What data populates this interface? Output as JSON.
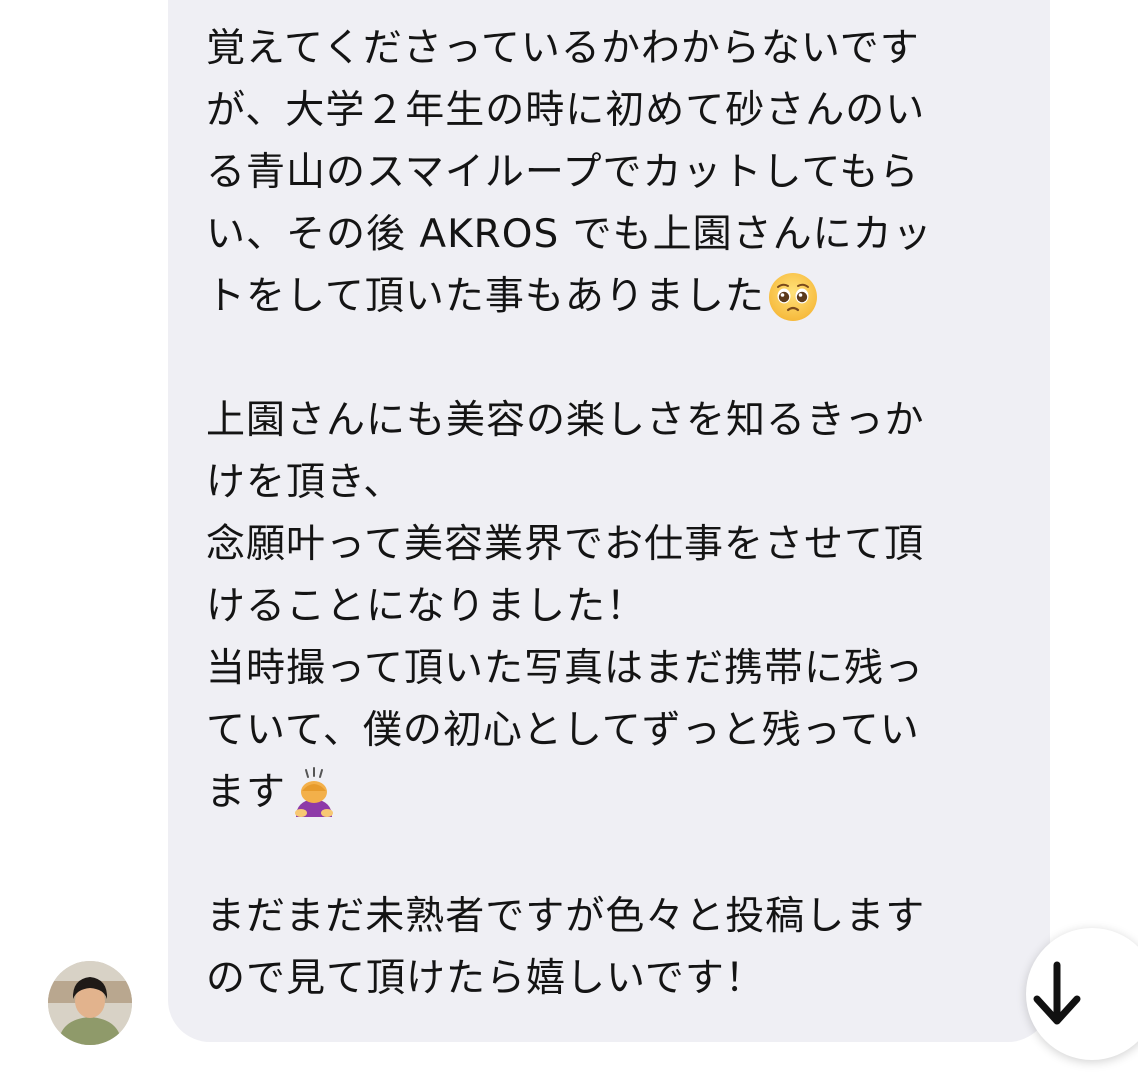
{
  "conversation": {
    "message": {
      "lines": [
        "覚えてくださっているかわからないです",
        "が、大学２年生の時に初めて砂さんのい",
        "る青山のスマイループでカットしてもら",
        "い、その後 AKROS でも上園さんにカッ",
        "トをして頂いた事もありました",
        "",
        "上園さんにも美容の楽しさを知るきっか",
        "けを頂き、",
        "念願叶って美容業界でお仕事をさせて頂",
        "けることになりました！",
        "当時撮って頂いた写真はまだ携帯に残っ",
        "ていて、僕の初心としてずっと残ってい",
        "ます",
        "",
        "まだまだ未熟者ですが色々と投稿します",
        "ので見て頂けたら嬉しいです！"
      ],
      "emojis": {
        "line_5": "pleading-face-emoji",
        "line_13": "person-bowing-emoji"
      }
    },
    "sender_avatar": "avatar",
    "scroll_button_icon": "arrow-down-icon"
  },
  "colors": {
    "bubble": "#efeff4",
    "text": "#141414",
    "background": "#ffffff"
  }
}
